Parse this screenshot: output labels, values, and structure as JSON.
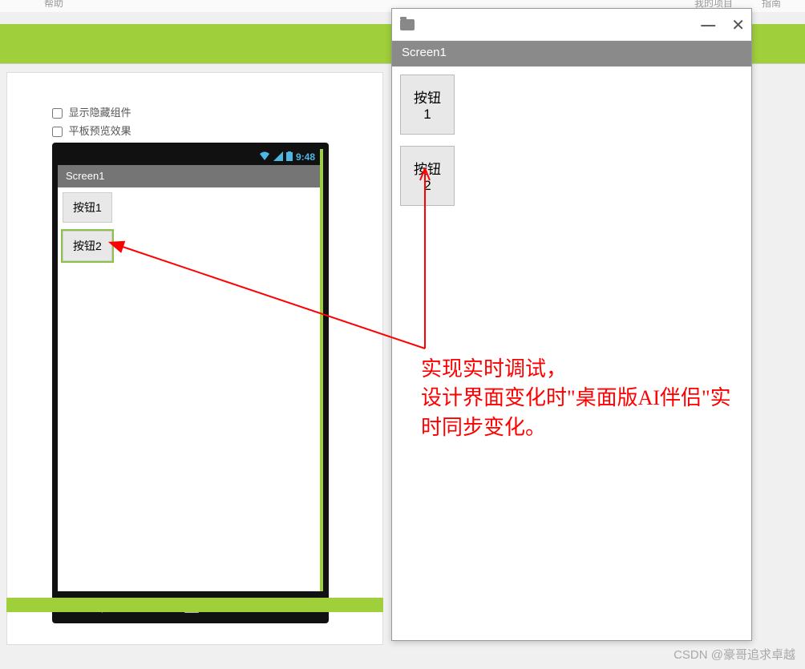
{
  "header": {
    "left_menu": "帮助",
    "right_menu_1": "我的项目",
    "right_menu_2": "指南"
  },
  "designer": {
    "checkbox_show_hidden": "显示隐藏组件",
    "checkbox_tablet_preview": "平板预览效果",
    "status_time": "9:48",
    "screen_title": "Screen1",
    "buttons": [
      "按钮1",
      "按钮2"
    ]
  },
  "companion": {
    "screen_title": "Screen1",
    "buttons": [
      "按钮1",
      "按钮2"
    ]
  },
  "annotation": {
    "text": "实现实时调试，\n设计界面变化时\"桌面版AI伴侣\"实时同步变化。"
  },
  "watermark": "CSDN @豪哥追求卓越",
  "colors": {
    "green": "#a0cf3c",
    "red": "#ff0000",
    "gray_title": "#757575"
  }
}
